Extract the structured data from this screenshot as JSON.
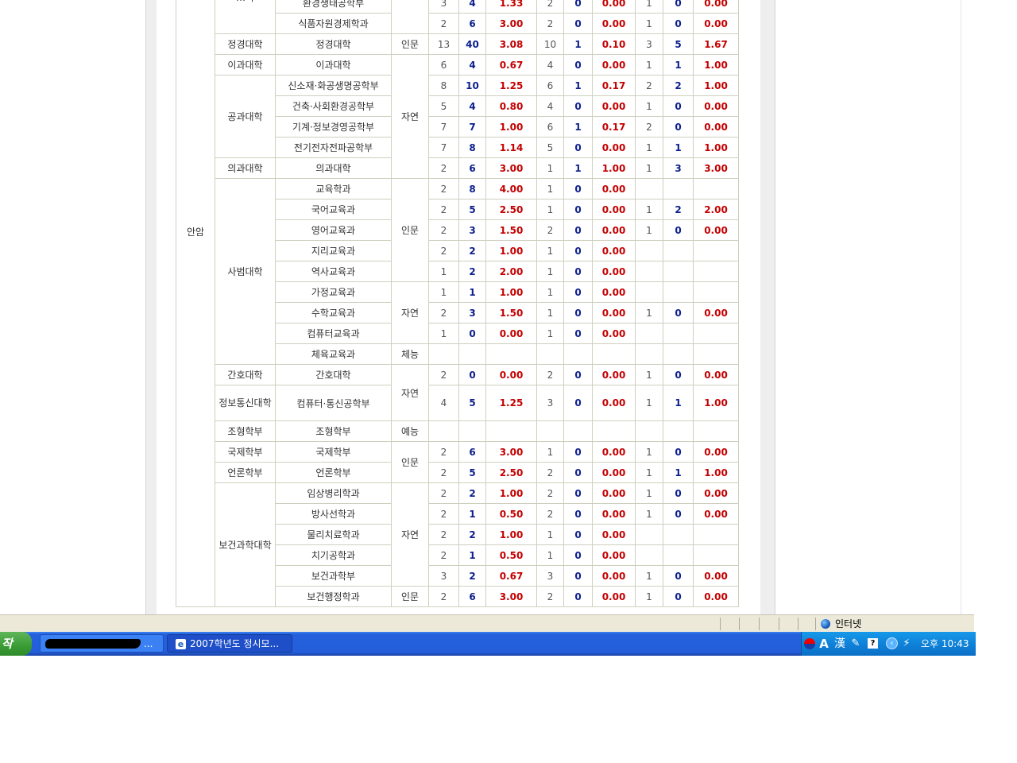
{
  "table": {
    "rows": [
      {
        "campus": "안암",
        "college": "…학",
        "dept": "환경생태공학부",
        "field": "",
        "c": [
          "3",
          "4",
          "1.33",
          "2",
          "0",
          "0.00",
          "1",
          "0",
          "0.00"
        ]
      },
      {
        "campus": "",
        "college": "",
        "dept": "식품자원경제학과",
        "field": "인문",
        "c": [
          "2",
          "6",
          "3.00",
          "2",
          "0",
          "0.00",
          "1",
          "0",
          "0.00"
        ]
      },
      {
        "campus": "",
        "college": "정경대학",
        "dept": "정경대학",
        "field": "인문",
        "c": [
          "13",
          "40",
          "3.08",
          "10",
          "1",
          "0.10",
          "3",
          "5",
          "1.67"
        ]
      },
      {
        "campus": "",
        "college": "이과대학",
        "dept": "이과대학",
        "field": "자연",
        "c": [
          "6",
          "4",
          "0.67",
          "4",
          "0",
          "0.00",
          "1",
          "1",
          "1.00"
        ]
      },
      {
        "campus": "",
        "college": "공과대학",
        "dept": "신소재·화공생명공학부",
        "field": "",
        "c": [
          "8",
          "10",
          "1.25",
          "6",
          "1",
          "0.17",
          "2",
          "2",
          "1.00"
        ]
      },
      {
        "campus": "",
        "college": "",
        "dept": "건축·사회환경공학부",
        "field": "",
        "c": [
          "5",
          "4",
          "0.80",
          "4",
          "0",
          "0.00",
          "1",
          "0",
          "0.00"
        ]
      },
      {
        "campus": "",
        "college": "",
        "dept": "기계·정보경영공학부",
        "field": "",
        "c": [
          "7",
          "7",
          "1.00",
          "6",
          "1",
          "0.17",
          "2",
          "0",
          "0.00"
        ]
      },
      {
        "campus": "",
        "college": "",
        "dept": "전기전자전파공학부",
        "field": "",
        "c": [
          "7",
          "8",
          "1.14",
          "5",
          "0",
          "0.00",
          "1",
          "1",
          "1.00"
        ]
      },
      {
        "campus": "",
        "college": "의과대학",
        "dept": "의과대학",
        "field": "",
        "c": [
          "2",
          "6",
          "3.00",
          "1",
          "1",
          "1.00",
          "1",
          "3",
          "3.00"
        ]
      },
      {
        "campus": "",
        "college": "사범대학",
        "dept": "교육학과",
        "field": "인문",
        "c": [
          "2",
          "8",
          "4.00",
          "1",
          "0",
          "0.00",
          "",
          "",
          ""
        ]
      },
      {
        "campus": "",
        "college": "",
        "dept": "국어교육과",
        "field": "",
        "c": [
          "2",
          "5",
          "2.50",
          "1",
          "0",
          "0.00",
          "1",
          "2",
          "2.00"
        ]
      },
      {
        "campus": "",
        "college": "",
        "dept": "영어교육과",
        "field": "",
        "c": [
          "2",
          "3",
          "1.50",
          "2",
          "0",
          "0.00",
          "1",
          "0",
          "0.00"
        ]
      },
      {
        "campus": "",
        "college": "",
        "dept": "지리교육과",
        "field": "",
        "c": [
          "2",
          "2",
          "1.00",
          "1",
          "0",
          "0.00",
          "",
          "",
          ""
        ]
      },
      {
        "campus": "",
        "college": "",
        "dept": "역사교육과",
        "field": "",
        "c": [
          "1",
          "2",
          "2.00",
          "1",
          "0",
          "0.00",
          "",
          "",
          ""
        ]
      },
      {
        "campus": "",
        "college": "",
        "dept": "가정교육과",
        "field": "자연",
        "c": [
          "1",
          "1",
          "1.00",
          "1",
          "0",
          "0.00",
          "",
          "",
          ""
        ]
      },
      {
        "campus": "",
        "college": "",
        "dept": "수학교육과",
        "field": "",
        "c": [
          "2",
          "3",
          "1.50",
          "1",
          "0",
          "0.00",
          "1",
          "0",
          "0.00"
        ]
      },
      {
        "campus": "",
        "college": "",
        "dept": "컴퓨터교육과",
        "field": "",
        "c": [
          "1",
          "0",
          "0.00",
          "1",
          "0",
          "0.00",
          "",
          "",
          ""
        ]
      },
      {
        "campus": "",
        "college": "",
        "dept": "체육교육과",
        "field": "체능",
        "c": [
          "",
          "",
          "",
          "",
          "",
          "",
          "",
          "",
          ""
        ]
      },
      {
        "campus": "",
        "college": "간호대학",
        "dept": "간호대학",
        "field": "자연",
        "c": [
          "2",
          "0",
          "0.00",
          "2",
          "0",
          "0.00",
          "1",
          "0",
          "0.00"
        ]
      },
      {
        "campus": "",
        "college": "정보통신대학",
        "dept": "컴퓨터·통신공학부",
        "field": "",
        "c": [
          "4",
          "5",
          "1.25",
          "3",
          "0",
          "0.00",
          "1",
          "1",
          "1.00"
        ]
      },
      {
        "campus": "",
        "college": "조형학부",
        "dept": "조형학부",
        "field": "예능",
        "c": [
          "",
          "",
          "",
          "",
          "",
          "",
          "",
          "",
          ""
        ]
      },
      {
        "campus": "",
        "college": "국제학부",
        "dept": "국제학부",
        "field": "인문",
        "c": [
          "2",
          "6",
          "3.00",
          "1",
          "0",
          "0.00",
          "1",
          "0",
          "0.00"
        ]
      },
      {
        "campus": "",
        "college": "언론학부",
        "dept": "언론학부",
        "field": "",
        "c": [
          "2",
          "5",
          "2.50",
          "2",
          "0",
          "0.00",
          "1",
          "1",
          "1.00"
        ]
      },
      {
        "campus": "",
        "college": "보건과학대학",
        "dept": "임상병리학과",
        "field": "자연",
        "c": [
          "2",
          "2",
          "1.00",
          "2",
          "0",
          "0.00",
          "1",
          "0",
          "0.00"
        ]
      },
      {
        "campus": "",
        "college": "",
        "dept": "방사선학과",
        "field": "",
        "c": [
          "2",
          "1",
          "0.50",
          "2",
          "0",
          "0.00",
          "1",
          "0",
          "0.00"
        ]
      },
      {
        "campus": "",
        "college": "",
        "dept": "물리치료학과",
        "field": "",
        "c": [
          "2",
          "2",
          "1.00",
          "1",
          "0",
          "0.00",
          "",
          "",
          ""
        ]
      },
      {
        "campus": "",
        "college": "",
        "dept": "치기공학과",
        "field": "",
        "c": [
          "2",
          "1",
          "0.50",
          "1",
          "0",
          "0.00",
          "",
          "",
          ""
        ]
      },
      {
        "campus": "",
        "college": "",
        "dept": "보건과학부",
        "field": "",
        "c": [
          "3",
          "2",
          "0.67",
          "3",
          "0",
          "0.00",
          "1",
          "0",
          "0.00"
        ]
      },
      {
        "campus": "",
        "college": "",
        "dept": "보건행정학과",
        "field": "인문",
        "c": [
          "2",
          "6",
          "3.00",
          "2",
          "0",
          "0.00",
          "1",
          "0",
          "0.00"
        ]
      }
    ]
  },
  "statusbar": {
    "zone": "인터넷"
  },
  "taskbar": {
    "start_label": "작",
    "task1_suffix": "...",
    "task2_label": "2007학년도 정시모...",
    "ie_icon_glyph": "e",
    "clock": "오후 10:43",
    "tray_icons": [
      "ime-circle-icon",
      "ime-a-icon",
      "ime-hanja-icon",
      "ime-tool-icon",
      "help-icon",
      "tray-expand-icon",
      "network-icon"
    ],
    "ime_a": "A",
    "ime_hanja": "漢",
    "help": "?",
    "expand": "‹"
  },
  "scrollbar": {
    "down_glyph": "▼"
  }
}
